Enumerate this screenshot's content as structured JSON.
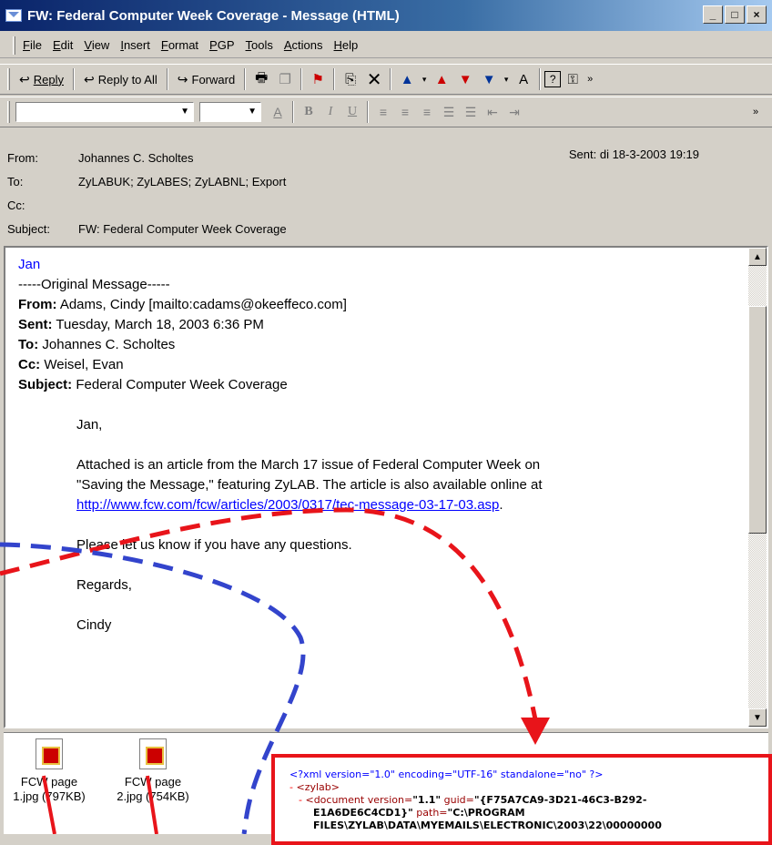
{
  "window": {
    "title": "FW: Federal Computer Week Coverage - Message (HTML)",
    "buttons": [
      "_",
      "□",
      "×"
    ]
  },
  "menus": [
    "File",
    "Edit",
    "View",
    "Insert",
    "Format",
    "PGP",
    "Tools",
    "Actions",
    "Help"
  ],
  "toolbar": {
    "reply": "Reply",
    "reply_all": "Reply to All",
    "forward": "Forward"
  },
  "headers": {
    "from_label": "From:",
    "from_value": "Johannes C. Scholtes",
    "to_label": "To:",
    "to_value": "ZyLABUK; ZyLABES; ZyLABNL; Export",
    "cc_label": "Cc:",
    "cc_value": "",
    "subject_label": "Subject:",
    "subject_value": "FW: Federal Computer Week Coverage",
    "sent_label": "Sent:",
    "sent_value": "di 18-3-2003 19:19"
  },
  "body": {
    "greeting": "Jan",
    "original_marker": "-----Original Message-----",
    "from_label": "From:",
    "from_value": " Adams, Cindy [mailto:cadams@okeeffeco.com]",
    "sent_label": "Sent:",
    "sent_value": " Tuesday, March 18, 2003 6:36 PM",
    "to_label": "To:",
    "to_value": " Johannes C. Scholtes",
    "cc_label": "Cc:",
    "cc_value": " Weisel, Evan",
    "subject_label": "Subject:",
    "subject_value": " Federal Computer Week Coverage",
    "salutation": "Jan,",
    "para1_line1": "Attached is an article from the March 17 issue of Federal Computer Week on",
    "para1_line2": "\"Saving the Message,\" featuring ZyLAB.  The article is also available online at",
    "link": "http://www.fcw.com/fcw/articles/2003/0317/tec-message-03-17-03.asp",
    "para1_end": ".",
    "para2": "Please let us know if you have any questions.",
    "closing": "Regards,",
    "signature": "Cindy"
  },
  "attachments": [
    {
      "line1": "FCW page",
      "line2": "1.jpg (797KB)"
    },
    {
      "line1": "FCW page",
      "line2": "2.jpg (754KB)"
    }
  ],
  "xml": {
    "line1": "<?xml version=\"1.0\" encoding=\"UTF-16\" standalone=\"no\" ?>",
    "line2_dash": "-",
    "line2_tag": "<zylab>",
    "line3_dash": "-",
    "line3_tag": "<document version=",
    "line3_ver": "\"1.1\"",
    "line3_guid_attr": " guid=",
    "line3_guid": "\"{F75A7CA9-3D21-46C3-B292-",
    "line4": "E1A6DE6C4CD1}\"",
    "line4_path_attr": " path=",
    "line4_path": "\"C:\\PROGRAM",
    "line5": "FILES\\ZYLAB\\DATA\\MYEMAILS\\ELECTRONIC\\2003\\22\\00000000"
  },
  "colors": {
    "title_gradient_start": "#0a246a",
    "red_annotation": "#e8141a",
    "blue_annotation": "#3344cc",
    "link": "#0000ff"
  }
}
